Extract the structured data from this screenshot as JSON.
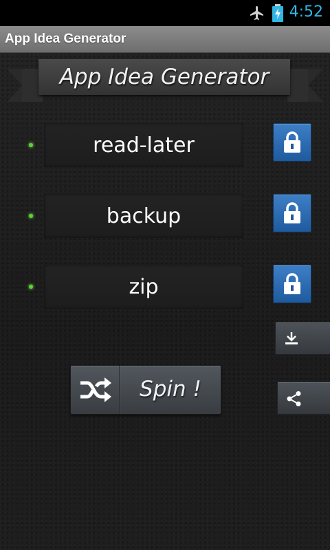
{
  "status_bar": {
    "time": "4:52",
    "icons": [
      "airplane-icon",
      "battery-charging-icon"
    ],
    "clock_color": "#33b5e5"
  },
  "action_bar": {
    "title": "App Idea Generator"
  },
  "banner": {
    "title": "App Idea Generator"
  },
  "ideas": [
    {
      "word": "read-later",
      "lock_icon": "lock-icon"
    },
    {
      "word": "backup",
      "lock_icon": "lock-icon"
    },
    {
      "word": "zip",
      "lock_icon": "lock-icon"
    }
  ],
  "side_buttons": {
    "download_icon": "download-icon",
    "share_icon": "share-icon"
  },
  "spin": {
    "label": "Spin !",
    "icon": "shuffle-icon"
  },
  "colors": {
    "accent_blue": "#2a6ab2",
    "indicator_green": "#5dd23a"
  }
}
